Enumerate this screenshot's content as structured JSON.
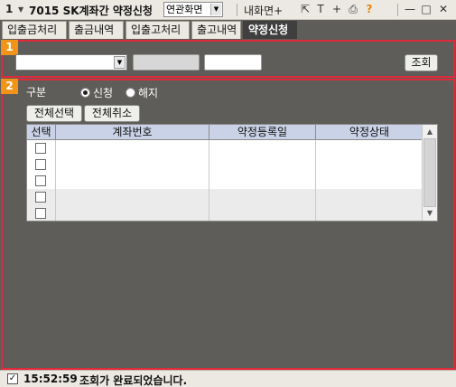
{
  "titlebar": {
    "screen_number": "1",
    "title": "7015 SK계좌간 약정신청",
    "combo_value": "연관화면",
    "my_screen_label": "내화면",
    "icons": [
      "plus-icon",
      "link-icon",
      "font-icon",
      "add-icon",
      "print-icon",
      "help-icon",
      "minimize-icon",
      "maximize-icon",
      "close-icon"
    ]
  },
  "tabs": [
    {
      "label": "입출금처리",
      "active": false
    },
    {
      "label": "출금내역",
      "active": false
    },
    {
      "label": "입출고처리",
      "active": false
    },
    {
      "label": "출고내역",
      "active": false
    },
    {
      "label": "약정신청",
      "active": true
    }
  ],
  "section1": {
    "badge": "1",
    "account_combo_value": "",
    "field_gray_value": "",
    "field_white_value": "",
    "search_label": "조회"
  },
  "section2": {
    "badge": "2",
    "gubun_label": "구분",
    "radio_apply_label": "신청",
    "radio_cancel_label": "해지",
    "radio_selected": "신청",
    "select_all_label": "전체선택",
    "cancel_all_label": "전체취소",
    "grid": {
      "columns": [
        "선택",
        "계좌번호",
        "약정등록일",
        "약정상태"
      ],
      "rows": [
        {
          "checked": false,
          "account": "",
          "reg_date": "",
          "status": ""
        },
        {
          "checked": false,
          "account": "",
          "reg_date": "",
          "status": ""
        },
        {
          "checked": false,
          "account": "",
          "reg_date": "",
          "status": ""
        },
        {
          "checked": false,
          "account": "",
          "reg_date": "",
          "status": ""
        },
        {
          "checked": false,
          "account": "",
          "reg_date": "",
          "status": ""
        }
      ]
    }
  },
  "status": {
    "checked": true,
    "time": "15:52:59",
    "message": "조회가 완료되었습니다."
  }
}
